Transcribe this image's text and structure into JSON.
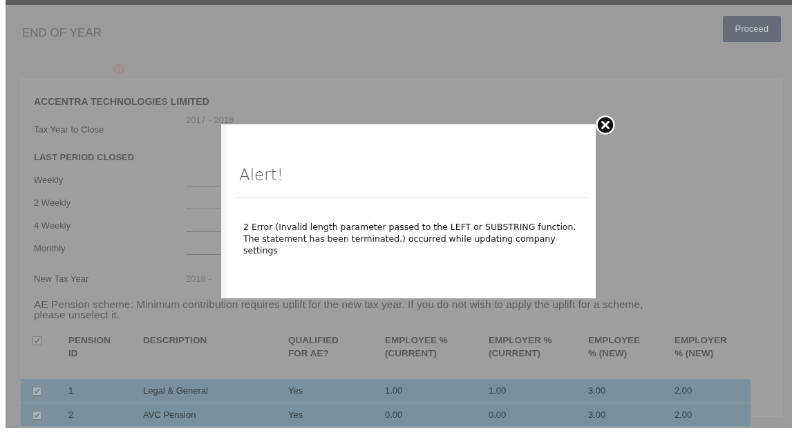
{
  "page": {
    "title": "END OF YEAR",
    "proceed_button": "Proceed"
  },
  "company": {
    "name": "ACCENTRA TECHNOLOGIES LIMITED",
    "tax_year_label": "Tax Year to Close",
    "tax_year_value": "2017 - 2018"
  },
  "last_period": {
    "heading": "LAST PERIOD CLOSED",
    "fields": [
      {
        "label": "Weekly"
      },
      {
        "label": "2 Weekly"
      },
      {
        "label": "4 Weekly"
      },
      {
        "label": "Monthly"
      }
    ]
  },
  "new_tax_year": {
    "label": "New Tax Year",
    "value": "2018 -"
  },
  "ae_note": "AE Pension scheme: Minimum contribution requires uplift for the new tax year. If you do not wish to apply the uplift for a scheme, please unselect it.",
  "table": {
    "select_all_checked": true,
    "columns": [
      "PENSION ID",
      "DESCRIPTION",
      "QUALIFIED FOR AE?",
      "EMPLOYEE % (CURRENT)",
      "EMPLOYER % (CURRENT)",
      "EMPLOYEE % (NEW)",
      "EMPLOYER % (NEW)"
    ],
    "rows": [
      {
        "checked": true,
        "selected": true,
        "cells": [
          "1",
          "Legal & General",
          "Yes",
          "1.00",
          "1.00",
          "3.00",
          "2.00"
        ]
      },
      {
        "checked": true,
        "selected": true,
        "cells": [
          "2",
          "AVC Pension",
          "Yes",
          "0.00",
          "0.00",
          "3.00",
          "2.00"
        ]
      }
    ]
  },
  "modal": {
    "title": "Alert!",
    "message": "2 Error (Invalid length parameter passed to the LEFT or SUBSTRING function.\nThe statement has been terminated.) occurred while updating company settings"
  }
}
